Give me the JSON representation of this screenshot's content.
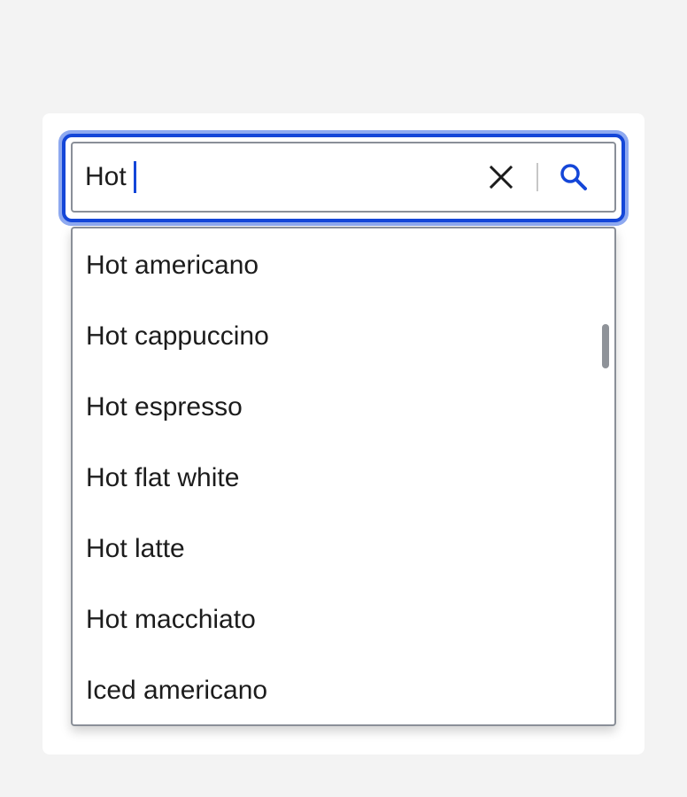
{
  "search": {
    "query": "Hot",
    "clear_icon": "close-icon",
    "search_icon": "search-icon",
    "accent_color": "#1446d8",
    "focus_ring_color": "#8ea9f0"
  },
  "results": {
    "items": [
      {
        "label": "Hot americano"
      },
      {
        "label": "Hot cappuccino"
      },
      {
        "label": "Hot espresso"
      },
      {
        "label": "Hot flat white"
      },
      {
        "label": "Hot latte"
      },
      {
        "label": "Hot macchiato"
      },
      {
        "label": "Iced americano"
      }
    ]
  }
}
